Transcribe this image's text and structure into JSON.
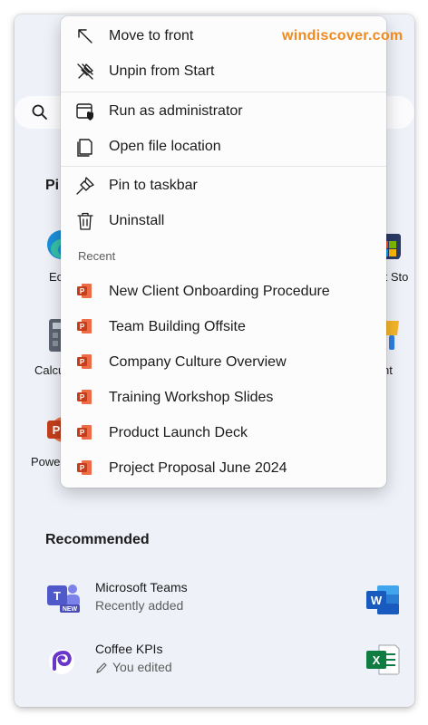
{
  "watermark": "windiscover.com",
  "start": {
    "pinned_label": "Pi",
    "pinned_apps": [
      {
        "label": "Ec",
        "icon": "edge-icon"
      },
      {
        "label": "ft Sto",
        "icon": "store-icon"
      },
      {
        "label": "Calcu",
        "icon": "calculator-icon"
      },
      {
        "label": "nt",
        "icon": "paint-icon"
      },
      {
        "label": "Powe",
        "icon": "powerpoint-icon"
      }
    ],
    "recommended_label": "Recommended",
    "recommended": [
      {
        "title": "Microsoft Teams",
        "subtitle": "Recently added",
        "icon": "teams-icon"
      },
      {
        "title": "Coffee KPIs",
        "subtitle": "You edited",
        "icon": "loop-icon",
        "subtitle_icon": "pencil-icon"
      }
    ],
    "recommended_right_icons": [
      "word-icon",
      "excel-icon"
    ]
  },
  "context_menu": {
    "items": [
      {
        "label": "Move to front",
        "icon": "move-to-front-icon"
      },
      {
        "label": "Unpin from Start",
        "icon": "unpin-icon"
      },
      {
        "label": "Run as administrator",
        "icon": "run-as-admin-icon"
      },
      {
        "label": "Open file location",
        "icon": "open-file-location-icon"
      },
      {
        "label": "Pin to taskbar",
        "icon": "pin-icon"
      },
      {
        "label": "Uninstall",
        "icon": "trash-icon"
      }
    ],
    "recent_label": "Recent",
    "recent": [
      {
        "label": "New Client Onboarding Procedure",
        "icon": "powerpoint-file-icon"
      },
      {
        "label": "Team Building Offsite",
        "icon": "powerpoint-file-icon"
      },
      {
        "label": "Company Culture Overview",
        "icon": "powerpoint-file-icon"
      },
      {
        "label": "Training Workshop Slides",
        "icon": "powerpoint-file-icon"
      },
      {
        "label": "Product Launch Deck",
        "icon": "powerpoint-file-icon"
      },
      {
        "label": "Project Proposal June 2024",
        "icon": "powerpoint-file-icon"
      }
    ]
  },
  "colors": {
    "watermark": "#f08a1e",
    "powerpoint": "#c43e1c",
    "word": "#185abd",
    "excel": "#107c41",
    "teams": "#5059c9"
  }
}
